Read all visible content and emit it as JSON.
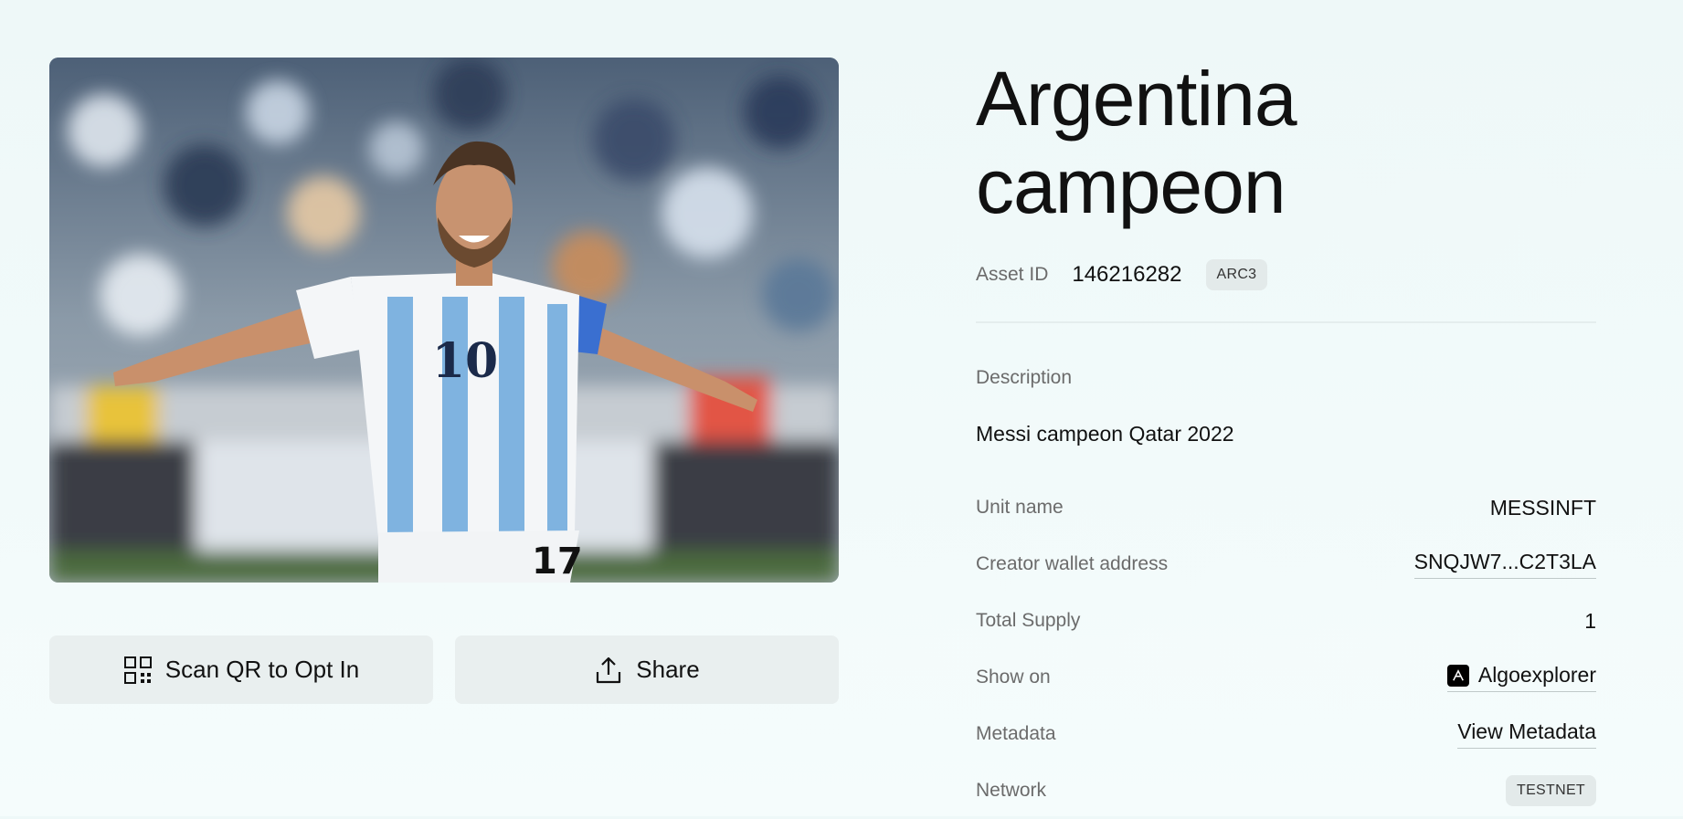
{
  "asset": {
    "title_line1": "Argentina",
    "title_line2": "campeon",
    "asset_id_label": "Asset ID",
    "asset_id": "146216282",
    "standard_badge": "ARC3"
  },
  "description": {
    "label": "Description",
    "text": "Messi campeon Qatar 2022"
  },
  "details": [
    {
      "label": "Unit name",
      "value": "MESSINFT"
    },
    {
      "label": "Creator wallet address",
      "value": "SNQJW7...C2T3LA"
    },
    {
      "label": "Total Supply",
      "value": "1"
    },
    {
      "label": "Show on",
      "value": "Algoexplorer",
      "icon": "algoexplorer-icon"
    },
    {
      "label": "Metadata",
      "value": "View Metadata"
    },
    {
      "label": "Network",
      "value": "TESTNET"
    }
  ],
  "actions": {
    "scan_label": "Scan QR to Opt In",
    "scan_icon": "qr-code-icon",
    "share_label": "Share",
    "share_icon": "share-icon"
  },
  "image": {
    "subject": "nft-image",
    "jersey_number": "10",
    "shorts_number": "17"
  },
  "colors": {
    "background": "#f0fafa",
    "button_bg": "#e9efef",
    "muted_text": "#6b6b6b",
    "badge_bg": "#e3eaea"
  }
}
